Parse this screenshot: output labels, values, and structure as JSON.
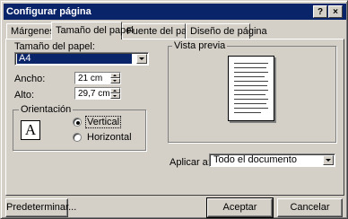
{
  "window": {
    "title": "Configurar página",
    "help_label": "?",
    "close_label": "×"
  },
  "tabs": [
    {
      "label": "Márgenes",
      "active": false
    },
    {
      "label": "Tamaño del papel",
      "active": true
    },
    {
      "label": "Fuente del papel",
      "active": false
    },
    {
      "label": "Diseño de página",
      "active": false
    }
  ],
  "paper": {
    "size_label": "Tamaño del papel:",
    "size_value": "A4",
    "width_label": "Ancho:",
    "width_value": "21 cm",
    "height_label": "Alto:",
    "height_value": "29,7 cm"
  },
  "orientation": {
    "legend": "Orientación",
    "icon_letter": "A",
    "vertical_label": "Vertical",
    "horizontal_label": "Horizontal",
    "selected": "Vertical"
  },
  "preview": {
    "legend": "Vista previa"
  },
  "apply": {
    "label": "Aplicar a:",
    "value": "Todo el documento"
  },
  "buttons": {
    "default_label": "Predeterminar...",
    "ok_label": "Aceptar",
    "cancel_label": "Cancelar"
  },
  "colors": {
    "titlebar": "#0a246a",
    "face": "#d4d0c8",
    "selection": "#0a246a"
  }
}
